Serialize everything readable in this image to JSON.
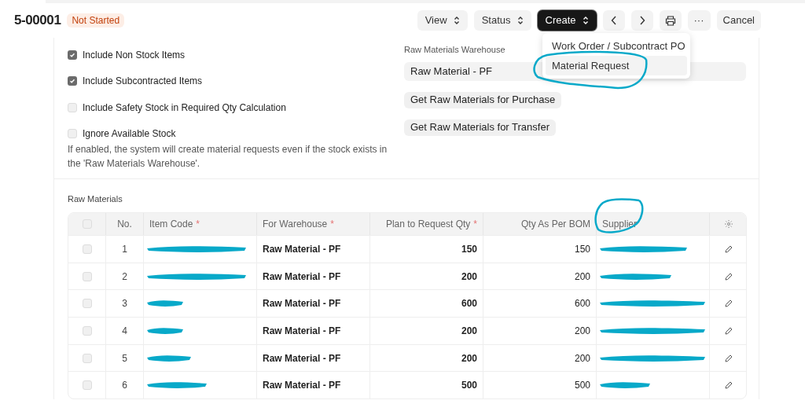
{
  "header": {
    "title": "5-00001",
    "status": "Not Started"
  },
  "toolbar": {
    "buttons": [
      {
        "label": "View",
        "kind": "select"
      },
      {
        "label": "Status",
        "kind": "select"
      },
      {
        "label": "Create",
        "kind": "primary"
      },
      {
        "kind": "prev"
      },
      {
        "kind": "next"
      },
      {
        "kind": "print"
      },
      {
        "label": "···",
        "kind": "text"
      },
      {
        "label": "Cancel",
        "kind": "text"
      }
    ]
  },
  "create_menu": {
    "items": [
      {
        "label": "Work Order / Subcontract PO",
        "selected": false
      },
      {
        "label": "Material Request",
        "selected": true
      }
    ]
  },
  "options": [
    {
      "label": "Include Non Stock Items",
      "checked": true
    },
    {
      "label": "Include Subcontracted Items",
      "checked": true
    },
    {
      "label": "Include Safety Stock in Required Qty Calculation",
      "checked": false
    },
    {
      "label": "Ignore Available Stock",
      "checked": false
    }
  ],
  "options_help": "If enabled, the system will create material requests even if the stock exists in the 'Raw Materials Warehouse'.",
  "warehouse": {
    "label": "Raw Materials Warehouse",
    "value": "Raw Material - PF"
  },
  "actions": [
    "Get Raw Materials for Purchase",
    "Get Raw Materials for Transfer"
  ],
  "table": {
    "title": "Raw Materials",
    "all_selected": false,
    "columns": [
      {
        "label": "No."
      },
      {
        "label": "Item Code",
        "required_mark": "*"
      },
      {
        "label": "For Warehouse",
        "required_mark": "*"
      },
      {
        "label": "Plan to Request Qty",
        "required_mark": "*"
      },
      {
        "label": "Qty As Per BOM"
      },
      {
        "label": "Supplier"
      }
    ],
    "rows": [
      {
        "selected": false,
        "no": "1",
        "warehouse": "Raw Material - PF",
        "plan_qty": "150",
        "bom_qty": "150"
      },
      {
        "selected": false,
        "no": "2",
        "warehouse": "Raw Material - PF",
        "plan_qty": "200",
        "bom_qty": "200"
      },
      {
        "selected": false,
        "no": "3",
        "warehouse": "Raw Material - PF",
        "plan_qty": "600",
        "bom_qty": "600"
      },
      {
        "selected": false,
        "no": "4",
        "warehouse": "Raw Material - PF",
        "plan_qty": "200",
        "bom_qty": "200"
      },
      {
        "selected": false,
        "no": "5",
        "warehouse": "Raw Material - PF",
        "plan_qty": "200",
        "bom_qty": "200"
      },
      {
        "selected": false,
        "no": "6",
        "warehouse": "Raw Material - PF",
        "plan_qty": "500",
        "bom_qty": "500"
      }
    ]
  }
}
